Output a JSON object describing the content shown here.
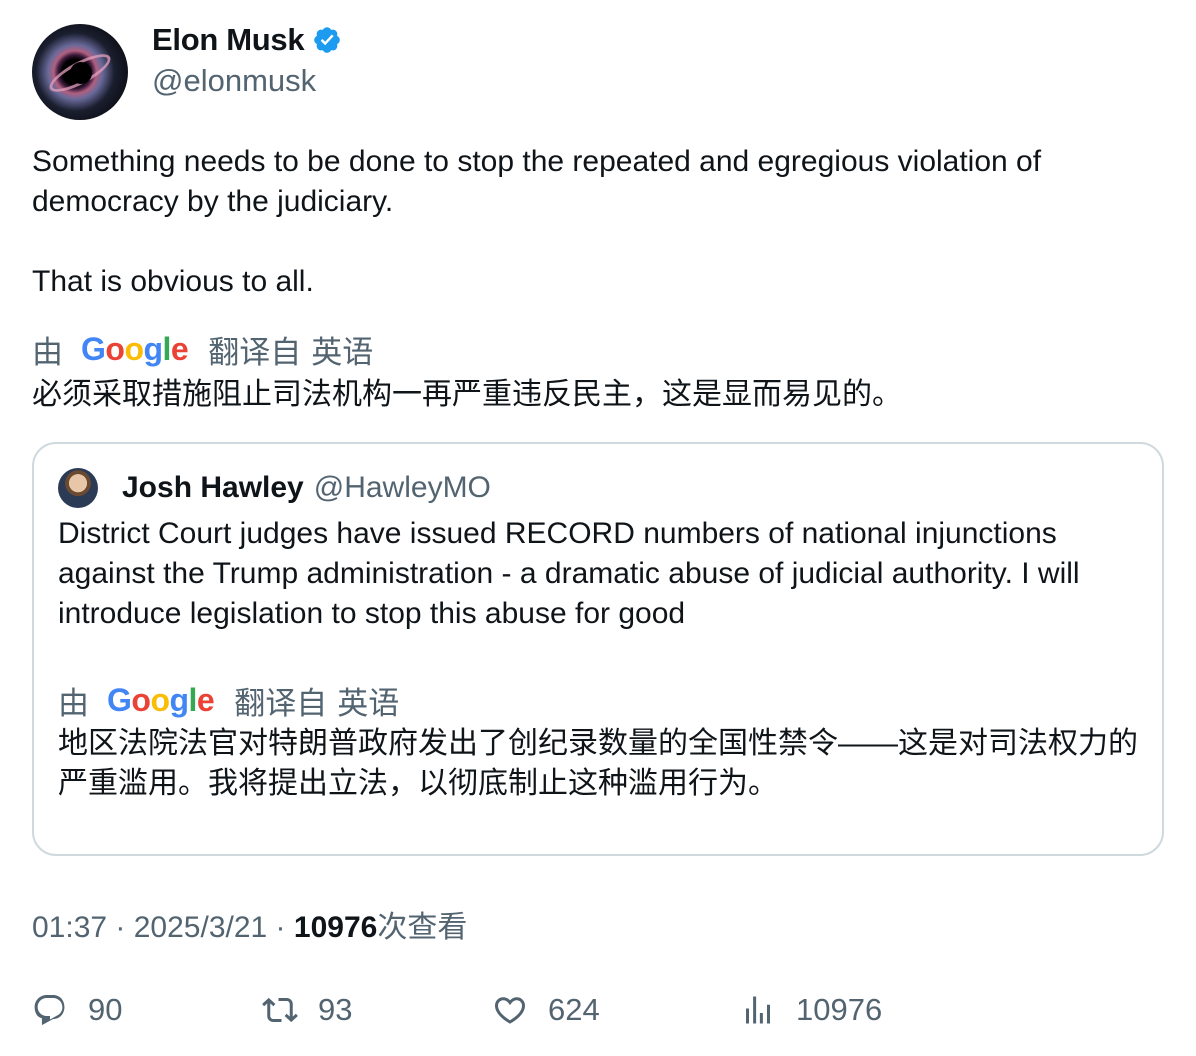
{
  "author": {
    "name": "Elon Musk",
    "handle": "@elonmusk",
    "verified_icon": "verified-badge-icon",
    "verified_color": "#1d9bf0"
  },
  "tweet": {
    "paragraph1": "Something needs to be done to stop the repeated and egregious violation of democracy by the judiciary.",
    "paragraph2": "That is obvious to all.",
    "translation": {
      "by": "由",
      "google_letters": [
        "G",
        "o",
        "o",
        "g",
        "l",
        "e"
      ],
      "translated_from": "翻译自",
      "language": "英语",
      "text": "必须采取措施阻止司法机构一再严重违反民主，这是显而易见的。"
    }
  },
  "quote": {
    "name": "Josh Hawley",
    "handle": "@HawleyMO",
    "text": "District Court judges have issued RECORD numbers of national injunctions against the Trump administration - a dramatic abuse of judicial authority. I will introduce legislation to stop this abuse for good",
    "translation": {
      "by": "由",
      "google_letters": [
        "G",
        "o",
        "o",
        "g",
        "l",
        "e"
      ],
      "translated_from": "翻译自",
      "language": "英语",
      "text": "地区法院法官对特朗普政府发出了创纪录数量的全国性禁令——这是对司法权力的严重滥用。我将提出立法，以彻底制止这种滥用行为。"
    }
  },
  "meta": {
    "time": "01:37",
    "separator": " · ",
    "date": "2025/3/21",
    "views_count": "10976",
    "views_label": "次查看"
  },
  "actions": {
    "replies": "90",
    "retweets": "93",
    "likes": "624",
    "views": "10976"
  },
  "colors": {
    "text": "#0f1419",
    "secondary": "#536471",
    "border": "#cfd9de",
    "google_blue": "#4285f4",
    "google_red": "#ea4335",
    "google_yellow": "#fbbc05",
    "google_green": "#34a853"
  }
}
